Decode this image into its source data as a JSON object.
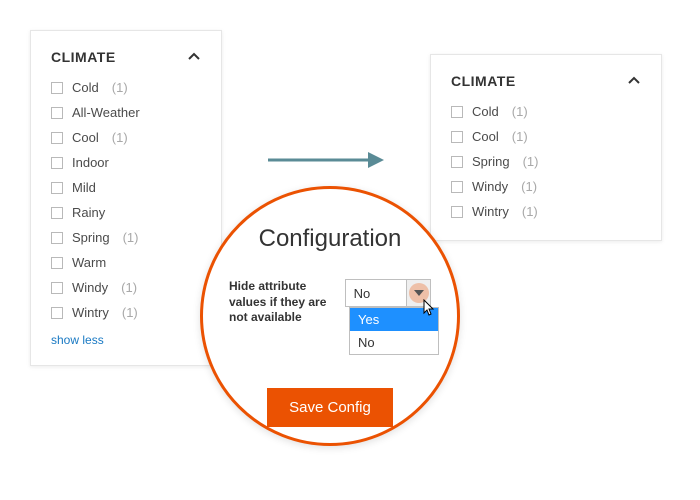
{
  "panelTitle": "CLIMATE",
  "leftFilters": [
    {
      "label": "Cold",
      "count": "1"
    },
    {
      "label": "All-Weather",
      "count": ""
    },
    {
      "label": "Cool",
      "count": "1"
    },
    {
      "label": "Indoor",
      "count": ""
    },
    {
      "label": "Mild",
      "count": ""
    },
    {
      "label": "Rainy",
      "count": ""
    },
    {
      "label": "Spring",
      "count": "1"
    },
    {
      "label": "Warm",
      "count": ""
    },
    {
      "label": "Windy",
      "count": "1"
    },
    {
      "label": "Wintry",
      "count": "1"
    }
  ],
  "showLess": "show less",
  "rightFilters": [
    {
      "label": "Cold",
      "count": "1"
    },
    {
      "label": "Cool",
      "count": "1"
    },
    {
      "label": "Spring",
      "count": "1"
    },
    {
      "label": "Windy",
      "count": "1"
    },
    {
      "label": "Wintry",
      "count": "1"
    }
  ],
  "config": {
    "title": "Configuration",
    "fieldLabel": "Hide attribute values if they are not available",
    "selectedValue": "No",
    "options": [
      "Yes",
      "No"
    ],
    "highlightedOption": "Yes",
    "saveLabel": "Save Config"
  },
  "colors": {
    "accent": "#eb5202",
    "link": "#1979c3",
    "dropdownHighlight": "#1e90ff"
  }
}
